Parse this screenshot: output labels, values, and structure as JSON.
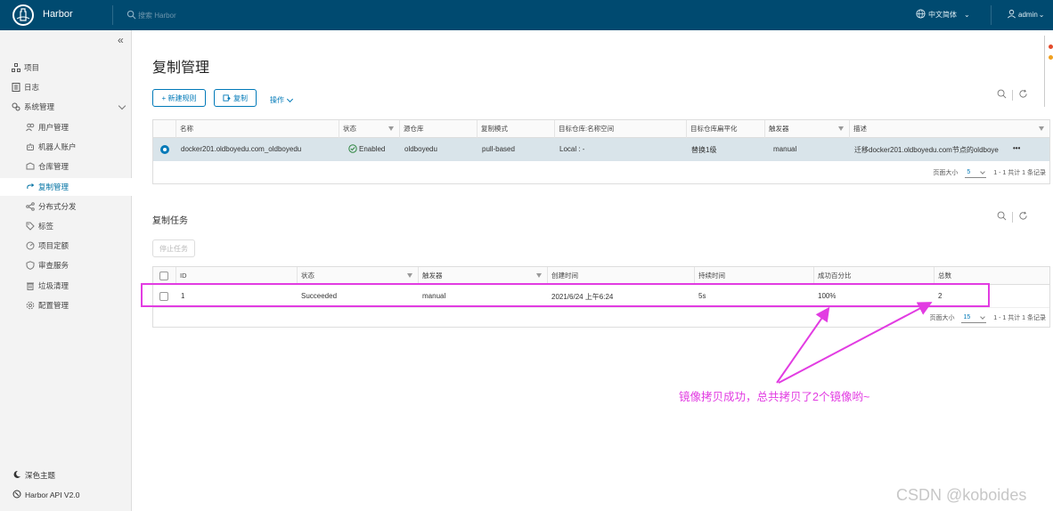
{
  "header": {
    "brand": "Harbor",
    "search_placeholder": "搜索 Harbor",
    "language": "中文简体",
    "user": "admin"
  },
  "sidebar": {
    "collapse": "«",
    "items": [
      {
        "label": "项目",
        "icon": "project-icon"
      },
      {
        "label": "日志",
        "icon": "log-icon"
      },
      {
        "label": "系统管理",
        "icon": "system-icon"
      },
      {
        "label": "用户管理",
        "icon": "users-icon"
      },
      {
        "label": "机器人账户",
        "icon": "robot-icon"
      },
      {
        "label": "仓库管理",
        "icon": "registry-icon"
      },
      {
        "label": "复制管理",
        "icon": "replication-icon"
      },
      {
        "label": "分布式分发",
        "icon": "share-icon"
      },
      {
        "label": "标签",
        "icon": "tag-icon"
      },
      {
        "label": "项目定额",
        "icon": "quota-icon"
      },
      {
        "label": "审查服务",
        "icon": "shield-icon"
      },
      {
        "label": "垃圾清理",
        "icon": "trash-icon"
      },
      {
        "label": "配置管理",
        "icon": "gear-icon"
      }
    ],
    "dark_theme": "深色主题",
    "api": "Harbor API V2.0"
  },
  "main": {
    "title": "复制管理",
    "new_rule": "+ 新建规则",
    "replicate": "复制",
    "actions": "操作",
    "rules_table": {
      "columns": [
        "名称",
        "状态",
        "源仓库",
        "复制模式",
        "目标仓库:名称空间",
        "目标仓库扁平化",
        "触发器",
        "描述"
      ],
      "rows": [
        {
          "name": "docker201.oldboyedu.com_oldboyedu",
          "status": "Enabled",
          "source": "oldboyedu",
          "mode": "pull-based",
          "dest": "Local : -",
          "flatten": "替换1级",
          "trigger": "manual",
          "desc": "迁移docker201.oldboyedu.com节点的oldboye",
          "more": "•••"
        }
      ],
      "page_size_label": "页面大小",
      "page_size": "5",
      "summary": "1 - 1 共计 1 条记录"
    },
    "tasks_title": "复制任务",
    "stop_task": "停止任务",
    "tasks_table": {
      "columns": [
        "ID",
        "状态",
        "触发器",
        "创建时间",
        "持续时间",
        "成功百分比",
        "总数"
      ],
      "rows": [
        {
          "id": "1",
          "status": "Succeeded",
          "trigger": "manual",
          "created": "2021/6/24 上午6:24",
          "duration": "5s",
          "percent": "100%",
          "total": "2"
        }
      ],
      "page_size_label": "页面大小",
      "page_size": "15",
      "summary": "1 - 1 共计 1 条记录"
    }
  },
  "annotation": "镜像拷贝成功，总共拷贝了2个镜像哟~",
  "watermark": "CSDN @koboides",
  "colors": {
    "header": "#004a70",
    "accent": "#0079b8",
    "annotation": "#e23ce2",
    "success": "#2e8540"
  }
}
